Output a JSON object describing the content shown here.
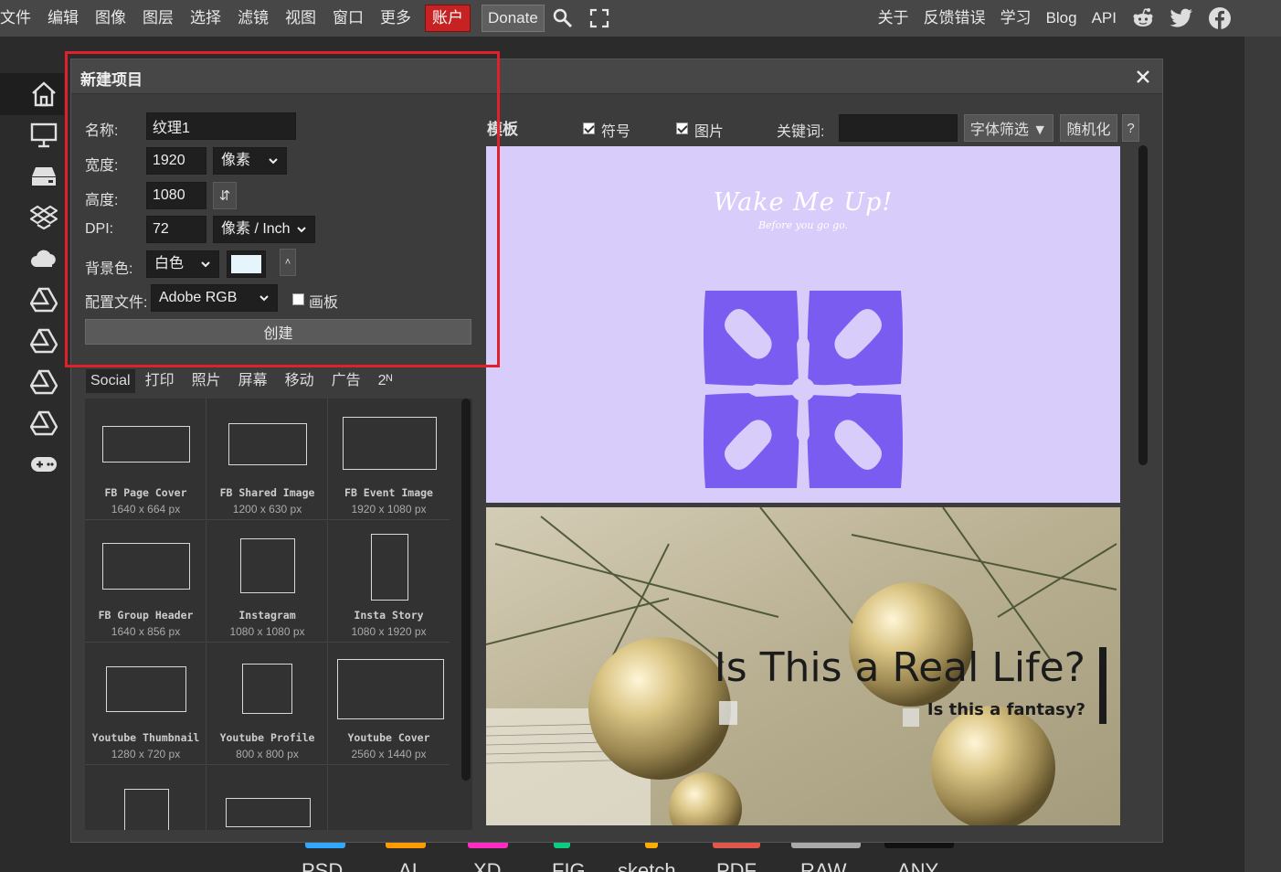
{
  "menubar": {
    "items": [
      "文件",
      "编辑",
      "图像",
      "图层",
      "选择",
      "滤镜",
      "视图",
      "窗口",
      "更多"
    ],
    "account": "账户",
    "donate": "Donate",
    "right_items": [
      "关于",
      "反馈错误",
      "学习",
      "Blog",
      "API"
    ]
  },
  "dialog": {
    "title": "新建项目",
    "name_label": "名称:",
    "name_value": "纹理1",
    "width_label": "宽度:",
    "width_value": "1920",
    "width_unit": "像素",
    "height_label": "高度:",
    "height_value": "1080",
    "swap_symbol": "⇵",
    "dpi_label": "DPI:",
    "dpi_value": "72",
    "dpi_unit": "像素 / Inch",
    "bg_label": "背景色:",
    "bg_value": "白色",
    "bg_color": "#e6f4fb",
    "bg_arrow": "˄",
    "profile_label": "配置文件:",
    "profile_value": "Adobe RGB",
    "artboard_label": "画板",
    "create_label": "创建"
  },
  "categories": [
    "Social",
    "打印",
    "照片",
    "屏幕",
    "移动",
    "广告",
    "2ᴺ"
  ],
  "presets": [
    {
      "name": "FB Page Cover",
      "size": "1640 x 664 px"
    },
    {
      "name": "FB Shared Image",
      "size": "1200 x 630 px"
    },
    {
      "name": "FB Event Image",
      "size": "1920 x 1080 px"
    },
    {
      "name": "FB Group Header",
      "size": "1640 x 856 px"
    },
    {
      "name": "Instagram",
      "size": "1080 x 1080 px"
    },
    {
      "name": "Insta Story",
      "size": "1080 x 1920 px"
    },
    {
      "name": "Youtube Thumbnail",
      "size": "1280 x 720 px"
    },
    {
      "name": "Youtube Profile",
      "size": "800 x 800 px"
    },
    {
      "name": "Youtube Cover",
      "size": "2560 x 1440 px"
    }
  ],
  "templates": {
    "label": "模板",
    "symbols_label": "符号",
    "images_label": "图片",
    "keyword_label": "关键词:",
    "font_filter": "字体筛选 ▼",
    "randomize": "随机化",
    "help": "?",
    "card1_title": "Wake Me Up!",
    "card1_sub": "Before you go go.",
    "card2_title": "Is This a Real Life?",
    "card2_sub": "Is this a fantasy?"
  },
  "formats": [
    "PSD",
    "AI",
    "XD",
    "FIG",
    "sketch",
    "PDF",
    "RAW",
    "ANY"
  ],
  "colors": {
    "accent_red": "#c62222",
    "highlight": "#e0202a",
    "flower": "#7b5cf0",
    "card1_bg": "#d8ccfb"
  }
}
